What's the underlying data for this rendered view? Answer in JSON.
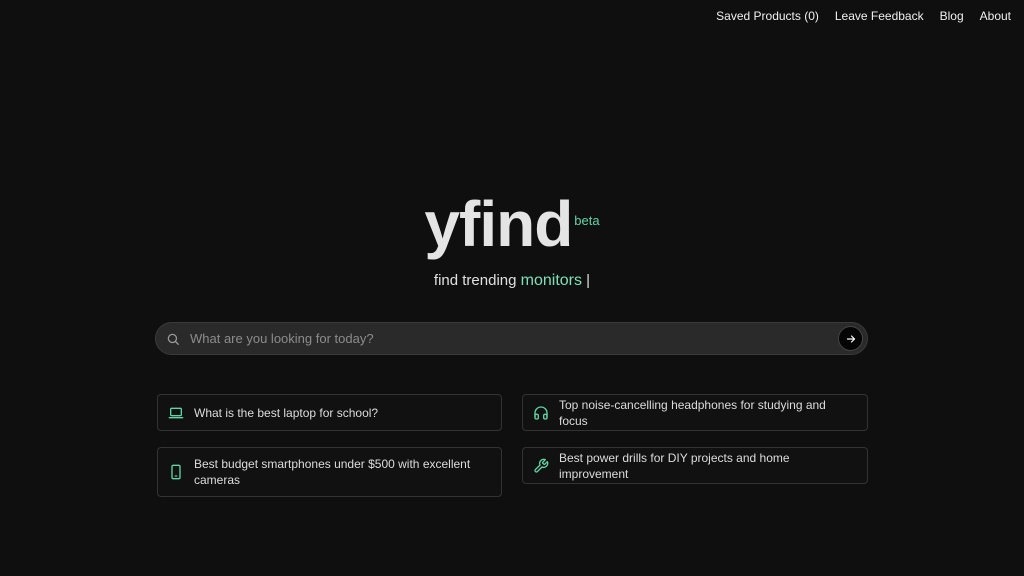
{
  "nav": {
    "saved_products": "Saved Products (0)",
    "leave_feedback": "Leave Feedback",
    "blog": "Blog",
    "about": "About"
  },
  "logo": {
    "word": "yfind",
    "badge": "beta"
  },
  "tagline": {
    "prefix": "find trending",
    "highlight": "monitors",
    "emoji": "",
    "cursor": "|"
  },
  "search": {
    "placeholder": "What are you looking for today?",
    "value": ""
  },
  "suggestions": [
    {
      "icon": "laptop-icon",
      "text": "What is the best laptop for school?"
    },
    {
      "icon": "headphones-icon",
      "text": "Top noise-cancelling headphones for studying and focus"
    },
    {
      "icon": "smartphone-icon",
      "text": "Best budget smartphones under $500 with excellent cameras"
    },
    {
      "icon": "wrench-icon",
      "text": "Best power drills for DIY projects and home improvement"
    }
  ],
  "colors": {
    "background": "#0f0f0f",
    "accent": "#5fd4a6",
    "search_bg": "#2a2a2a"
  }
}
